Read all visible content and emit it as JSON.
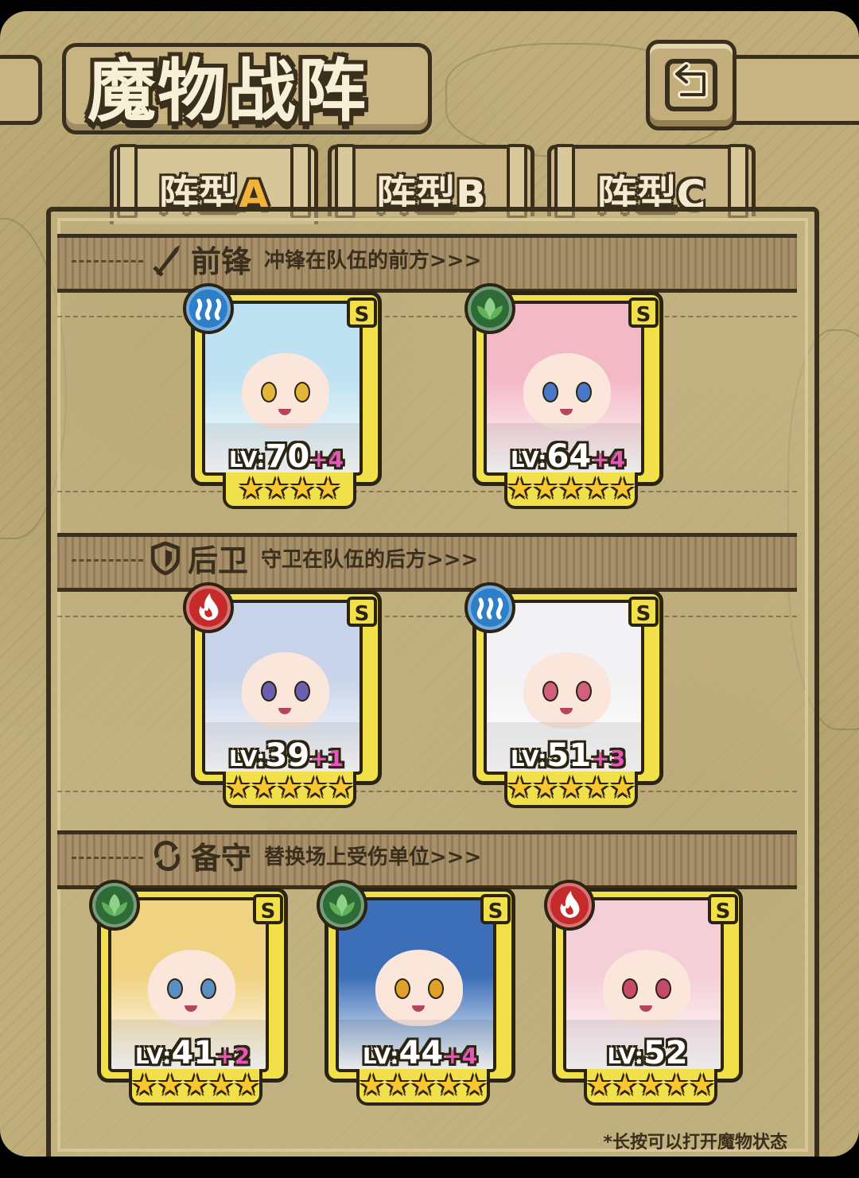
{
  "header": {
    "title": "魔物战阵",
    "back_icon": "return-arrow-icon"
  },
  "tabs": [
    {
      "label": "阵型",
      "letter": "A",
      "active": true
    },
    {
      "label": "阵型",
      "letter": "B",
      "active": false
    },
    {
      "label": "阵型",
      "letter": "C",
      "active": false
    }
  ],
  "sections": [
    {
      "icon": "sword-icon",
      "title": "前锋",
      "subtitle": "冲锋在队伍的前方>>>",
      "cards": [
        {
          "element": "water",
          "rank": "S",
          "level_prefix": "LV:",
          "level": "70",
          "bonus": "+4",
          "stars": 4,
          "hair": "#bfe2f2",
          "eyes": "#e3b53a"
        },
        {
          "element": "grass",
          "rank": "S",
          "level_prefix": "LV:",
          "level": "64",
          "bonus": "+4",
          "stars": 5,
          "hair": "#f3b9c6",
          "eyes": "#4a78c9"
        }
      ]
    },
    {
      "icon": "shield-icon",
      "title": "后卫",
      "subtitle": "守卫在队伍的后方>>>",
      "cards": [
        {
          "element": "fire",
          "rank": "S",
          "level_prefix": "LV:",
          "level": "39",
          "bonus": "+1",
          "stars": 5,
          "hair": "#c9d4ea",
          "eyes": "#6a5fb0"
        },
        {
          "element": "water",
          "rank": "S",
          "level_prefix": "LV:",
          "level": "51",
          "bonus": "+3",
          "stars": 5,
          "hair": "#f2f2f4",
          "eyes": "#d2607c"
        }
      ]
    },
    {
      "icon": "swap-icon",
      "title": "备守",
      "subtitle": "替换场上受伤单位>>>",
      "cards": [
        {
          "element": "grass",
          "rank": "S",
          "level_prefix": "LV:",
          "level": "41",
          "bonus": "+2",
          "stars": 5,
          "hair": "#f0d283",
          "eyes": "#5a8fc5"
        },
        {
          "element": "grass",
          "rank": "S",
          "level_prefix": "LV:",
          "level": "44",
          "bonus": "+4",
          "stars": 5,
          "hair": "#3c6fb8",
          "eyes": "#e0a12a"
        },
        {
          "element": "fire",
          "rank": "S",
          "level_prefix": "LV:",
          "level": "52",
          "bonus": "",
          "stars": 5,
          "hair": "#f5cfd8",
          "eyes": "#c64a6a"
        }
      ]
    }
  ],
  "footer": {
    "hint": "*长按可以打开魔物状态"
  },
  "colors": {
    "card_border": "#f1e04a",
    "water": "#2f7ec8",
    "grass": "#2f6b36",
    "fire": "#c62b2b",
    "bonus": "#e655b8",
    "outline": "#3a2e1c"
  }
}
